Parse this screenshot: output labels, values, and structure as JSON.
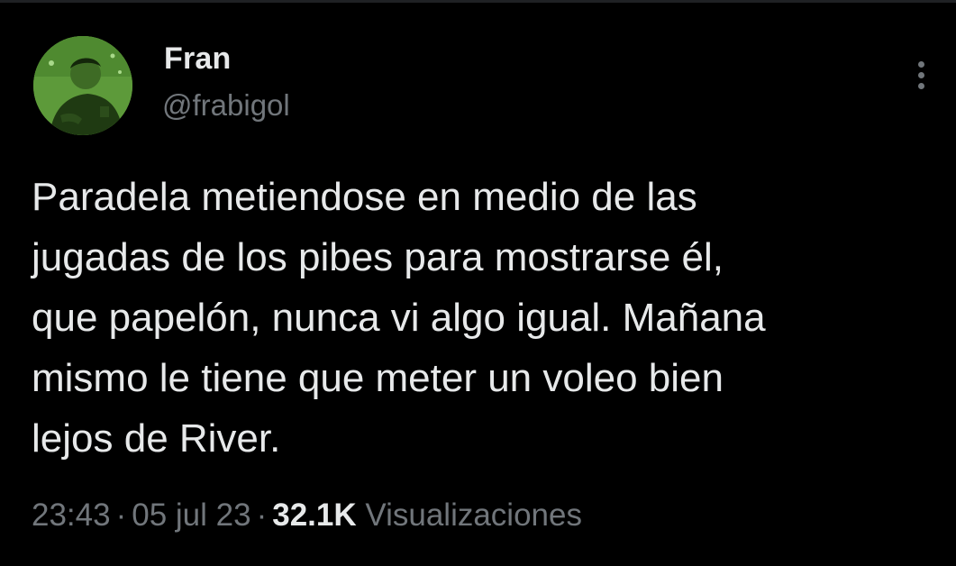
{
  "author": {
    "display_name": "Fran",
    "handle": "@frabigol"
  },
  "tweet": {
    "text": "Paradela metiendose en medio de las\njugadas de los pibes para mostrarse él,\nque papelón, nunca vi algo igual. Mañana\nmismo le tiene que meter un voleo bien\nlejos de River."
  },
  "meta": {
    "time": "23:43",
    "separator": "·",
    "date": "05 jul 23",
    "views_count": "32.1K",
    "views_label": "Visualizaciones"
  },
  "icons": {
    "more": "more-vertical-icon"
  },
  "colors": {
    "background": "#000000",
    "primary_text": "#e7e9ea",
    "secondary_text": "#71767b",
    "avatar_tint": "#5d9a3a"
  }
}
